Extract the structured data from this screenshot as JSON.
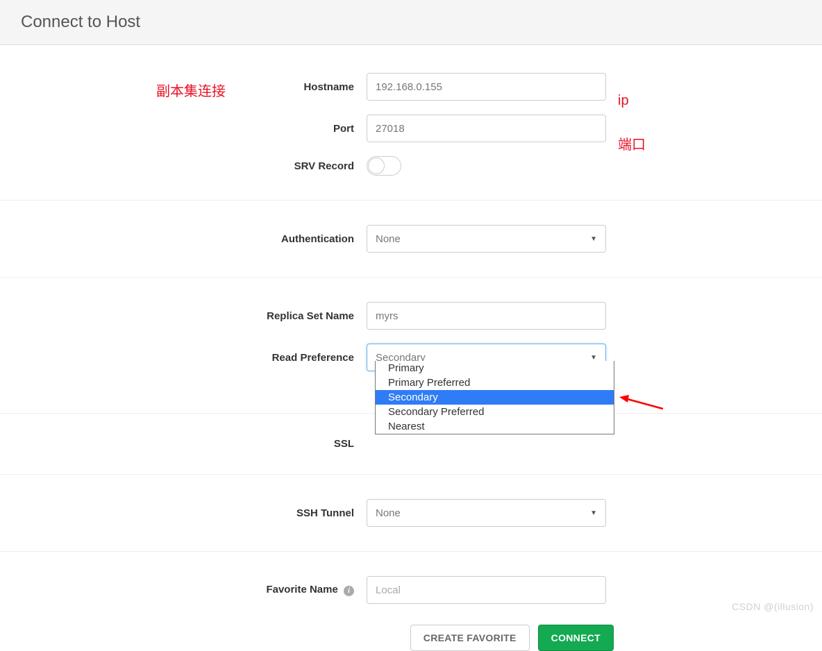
{
  "header": {
    "title": "Connect to Host"
  },
  "annotations": {
    "top": "副本集连接",
    "ip": "ip",
    "port": "端口"
  },
  "form": {
    "hostname": {
      "label": "Hostname",
      "value": "192.168.0.155"
    },
    "port": {
      "label": "Port",
      "value": "27018"
    },
    "srv": {
      "label": "SRV Record"
    },
    "auth": {
      "label": "Authentication",
      "value": "None"
    },
    "replicaSet": {
      "label": "Replica Set Name",
      "value": "myrs"
    },
    "readPref": {
      "label": "Read Preference",
      "value": "Secondary",
      "options": [
        "Primary",
        "Primary Preferred",
        "Secondary",
        "Secondary Preferred",
        "Nearest"
      ]
    },
    "ssl": {
      "label": "SSL"
    },
    "sshTunnel": {
      "label": "SSH Tunnel",
      "value": "None"
    },
    "favoriteName": {
      "label": "Favorite Name",
      "placeholder": "Local"
    }
  },
  "buttons": {
    "createFavorite": "CREATE FAVORITE",
    "connect": "CONNECT"
  },
  "watermark": "CSDN @(illusion)"
}
